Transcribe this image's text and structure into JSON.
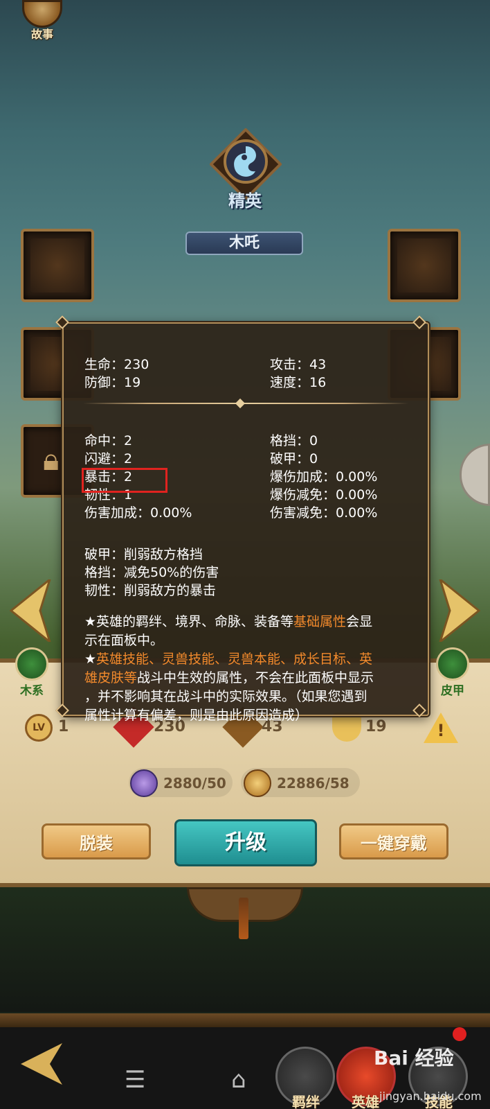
{
  "story_label": "故事",
  "rank_label": "精英",
  "hero_name": "木吒",
  "side_badges": {
    "left": "木系",
    "right": "皮甲"
  },
  "stats_row": {
    "level_badge": "LV",
    "level": "1",
    "hp": "230",
    "attack": "43",
    "defense": "19"
  },
  "resources": {
    "exp": "2880/50",
    "coins": "22886/58"
  },
  "buttons": {
    "unequip": "脱装",
    "upgrade": "升级",
    "equip_all": "一键穿戴"
  },
  "bottom_tabs": {
    "bond": "羁绊",
    "hero": "英雄",
    "skill": "技能"
  },
  "watermark": {
    "brand": "Bai  经验",
    "url": "jingyan.baidu.com"
  },
  "tooltip": {
    "base": [
      {
        "label": "生命：",
        "value": "230"
      },
      {
        "label": "攻击：",
        "value": "43"
      },
      {
        "label": "防御：",
        "value": "19"
      },
      {
        "label": "速度：",
        "value": "16"
      }
    ],
    "left_stats": [
      {
        "label": "命中：",
        "value": "2"
      },
      {
        "label": "闪避：",
        "value": "2"
      },
      {
        "label": "暴击：",
        "value": "2"
      },
      {
        "label": "韧性：",
        "value": "1"
      },
      {
        "label": "伤害加成：",
        "value": "0.00%"
      }
    ],
    "right_stats": [
      {
        "label": "格挡：",
        "value": "0"
      },
      {
        "label": "破甲：",
        "value": "0"
      },
      {
        "label": "爆伤加成：",
        "value": "0.00%"
      },
      {
        "label": "爆伤减免：",
        "value": "0.00%"
      },
      {
        "label": "伤害减免：",
        "value": "0.00%"
      }
    ],
    "descriptions": [
      "破甲：削弱敌方格挡",
      "格挡：减免50%的伤害",
      "韧性：削弱敌方的暴击"
    ],
    "note1": {
      "star": "★英雄的羁绊、境界、命脉、装备等",
      "hl": "基础属性",
      "tail1": "会显",
      "tail2": "示在面板中。"
    },
    "note2": {
      "star": "★",
      "hl1": "英雄技能、灵兽技能、灵兽本能、成长目标、英",
      "hl2": "雄皮肤等",
      "tail1": "战斗中生效的属性，不会在此面板中显示",
      "tail2": "，并不影响其在战斗中的实际效果。（如果您遇到",
      "tail3": "属性计算有偏差，则是由此原因造成）"
    }
  },
  "colors": {
    "highlight": "#f28a2c",
    "annotation_box": "#e0231f",
    "panel_bg": "#2c2218",
    "upgrade_btn": "#2aa3a3"
  }
}
